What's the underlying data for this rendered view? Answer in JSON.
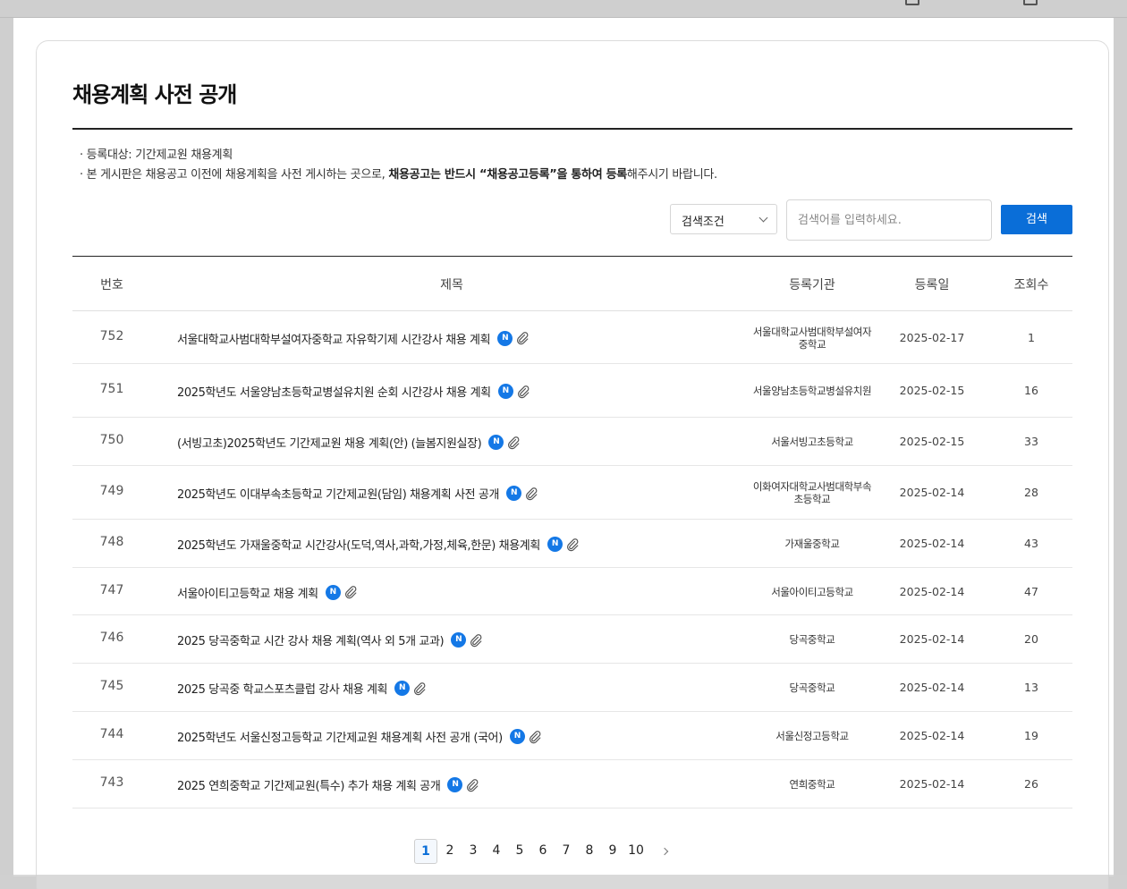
{
  "page": {
    "title": "채용계획 사전 공개",
    "notes": [
      "· 등록대상: 기간제교원 채용계획",
      "· 본 게시판은 채용공고 이전에 채용계획을 사전 게시하는 곳으로, ",
      "채용공고는 반드시 “채용공고등록”을 통하여 등록",
      "해주시기 바랍니다."
    ]
  },
  "search": {
    "condition": "검색조건",
    "placeholder": "검색어를 입력하세요.",
    "button": "검색"
  },
  "table": {
    "headers": [
      "번호",
      "제목",
      "등록기관",
      "등록일",
      "조회수"
    ],
    "new_badge": "N",
    "rows": [
      {
        "num": "752",
        "title": "서울대학교사범대학부설여자중학교 자유학기제 시간강사 채용 계획",
        "org": "서울대학교사범대학부설여자중학교",
        "date": "2025-02-17",
        "views": "1"
      },
      {
        "num": "751",
        "title": "2025학년도 서울양남초등학교병설유치원 순회 시간강사 채용 계획",
        "org": "서울양남초등학교병설유치원",
        "date": "2025-02-15",
        "views": "16"
      },
      {
        "num": "750",
        "title": "(서빙고초)2025학년도 기간제교원 채용 계획(안) (늘봄지원실장)",
        "org": "서울서빙고초등학교",
        "date": "2025-02-15",
        "views": "33"
      },
      {
        "num": "749",
        "title": "2025학년도 이대부속초등학교 기간제교원(담임) 채용계획 사전 공개",
        "org": "이화여자대학교사범대학부속초등학교",
        "date": "2025-02-14",
        "views": "28"
      },
      {
        "num": "748",
        "title": "2025학년도 가재울중학교 시간강사(도덕,역사,과학,가정,체육,한문) 채용계획",
        "org": "가재울중학교",
        "date": "2025-02-14",
        "views": "43"
      },
      {
        "num": "747",
        "title": "서울아이티고등학교 채용 계획",
        "org": "서울아이티고등학교",
        "date": "2025-02-14",
        "views": "47"
      },
      {
        "num": "746",
        "title": "2025 당곡중학교 시간 강사 채용 계획(역사 외 5개 교과)",
        "org": "당곡중학교",
        "date": "2025-02-14",
        "views": "20"
      },
      {
        "num": "745",
        "title": "2025 당곡중 학교스포츠클럽 강사 채용 계획",
        "org": "당곡중학교",
        "date": "2025-02-14",
        "views": "13"
      },
      {
        "num": "744",
        "title": "2025학년도 서울신정고등학교 기간제교원 채용계획 사전 공개 (국어)",
        "org": "서울신정고등학교",
        "date": "2025-02-14",
        "views": "19"
      },
      {
        "num": "743",
        "title": "2025 연희중학교 기간제교원(특수) 추가 채용 계획 공개",
        "org": "연희중학교",
        "date": "2025-02-14",
        "views": "26"
      }
    ]
  },
  "pagination": {
    "pages": [
      "1",
      "2",
      "3",
      "4",
      "5",
      "6",
      "7",
      "8",
      "9",
      "10"
    ],
    "current": "1"
  },
  "colors": {
    "accent": "#0a6ed8",
    "badge": "#1478e6"
  }
}
